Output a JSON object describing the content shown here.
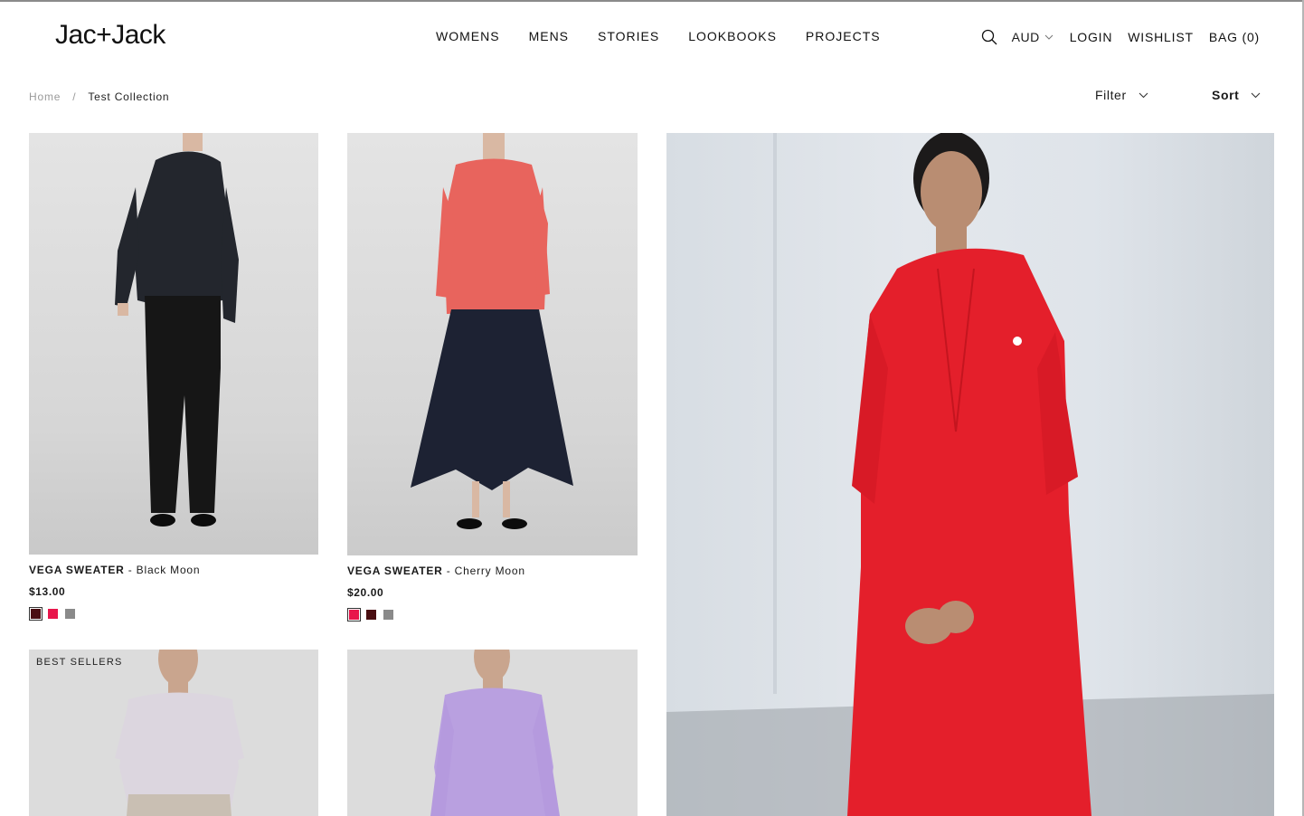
{
  "brand": {
    "logo_text": "Jac+Jack"
  },
  "nav": [
    "WOMENS",
    "MENS",
    "STORIES",
    "LOOKBOOKS",
    "PROJECTS"
  ],
  "utility": {
    "currency": "AUD",
    "login": "LOGIN",
    "wishlist": "WISHLIST",
    "bag": "BAG (0)"
  },
  "breadcrumb": {
    "home": "Home",
    "separator": "/",
    "current": "Test Collection"
  },
  "controls": {
    "filter": "Filter",
    "sort": "Sort"
  },
  "products": [
    {
      "name": "VEGA SWEATER",
      "variant": " - Black Moon",
      "price": "$13.00",
      "swatches": [
        "#4a0e12",
        "#e8164b",
        "#8a8a8a"
      ],
      "selected_swatch": 0
    },
    {
      "name": "VEGA SWEATER",
      "variant": " - Cherry Moon",
      "price": "$20.00",
      "swatches": [
        "#e8164b",
        "#4a0e12",
        "#8a8a8a"
      ],
      "selected_swatch": 0
    },
    {
      "badge": "BEST SELLERS"
    },
    {}
  ],
  "colors": {
    "text": "#111111",
    "muted": "#9a9a9a",
    "image_bg": "#d9d9d9",
    "feature_red": "#e41f2b"
  }
}
